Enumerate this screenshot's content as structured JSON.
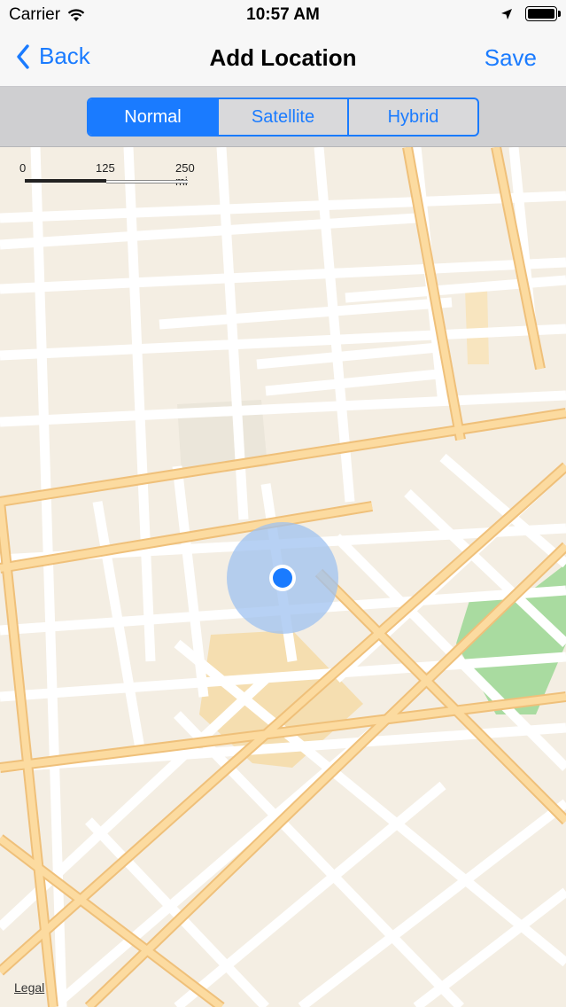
{
  "status_bar": {
    "carrier": "Carrier",
    "time": "10:57 AM"
  },
  "nav": {
    "back_label": "Back",
    "title": "Add Location",
    "save_label": "Save"
  },
  "map_type": {
    "options": [
      "Normal",
      "Satellite",
      "Hybrid"
    ],
    "selected": "Normal"
  },
  "map": {
    "scale_labels": [
      "0",
      "125",
      "250 mi"
    ],
    "legal_label": "Legal",
    "user_location_color": "#1a7bff",
    "accuracy_ring_color": "#9fc2f0"
  },
  "colors": {
    "accent": "#1a7bff",
    "land": "#f4eee3",
    "street": "#ffffff",
    "major_road": "#fbd99a",
    "park": "#a9dba0"
  }
}
